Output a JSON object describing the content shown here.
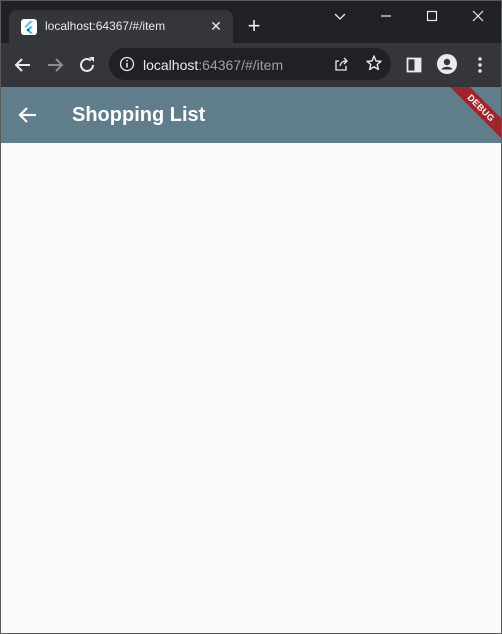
{
  "browser": {
    "tab": {
      "title": "localhost:64367/#/item",
      "favicon": "flutter-icon",
      "close": "✕"
    },
    "new_tab": "+",
    "window_controls": {
      "chevron": "chevron-down-icon",
      "minimize": "minimize-icon",
      "maximize": "maximize-icon",
      "close": "close-icon"
    },
    "address": {
      "host": "localhost",
      "rest": ":64367/#/item"
    }
  },
  "app": {
    "title": "Shopping List",
    "debug_banner": "DEBUG",
    "appbar_color": "#607d8b"
  }
}
